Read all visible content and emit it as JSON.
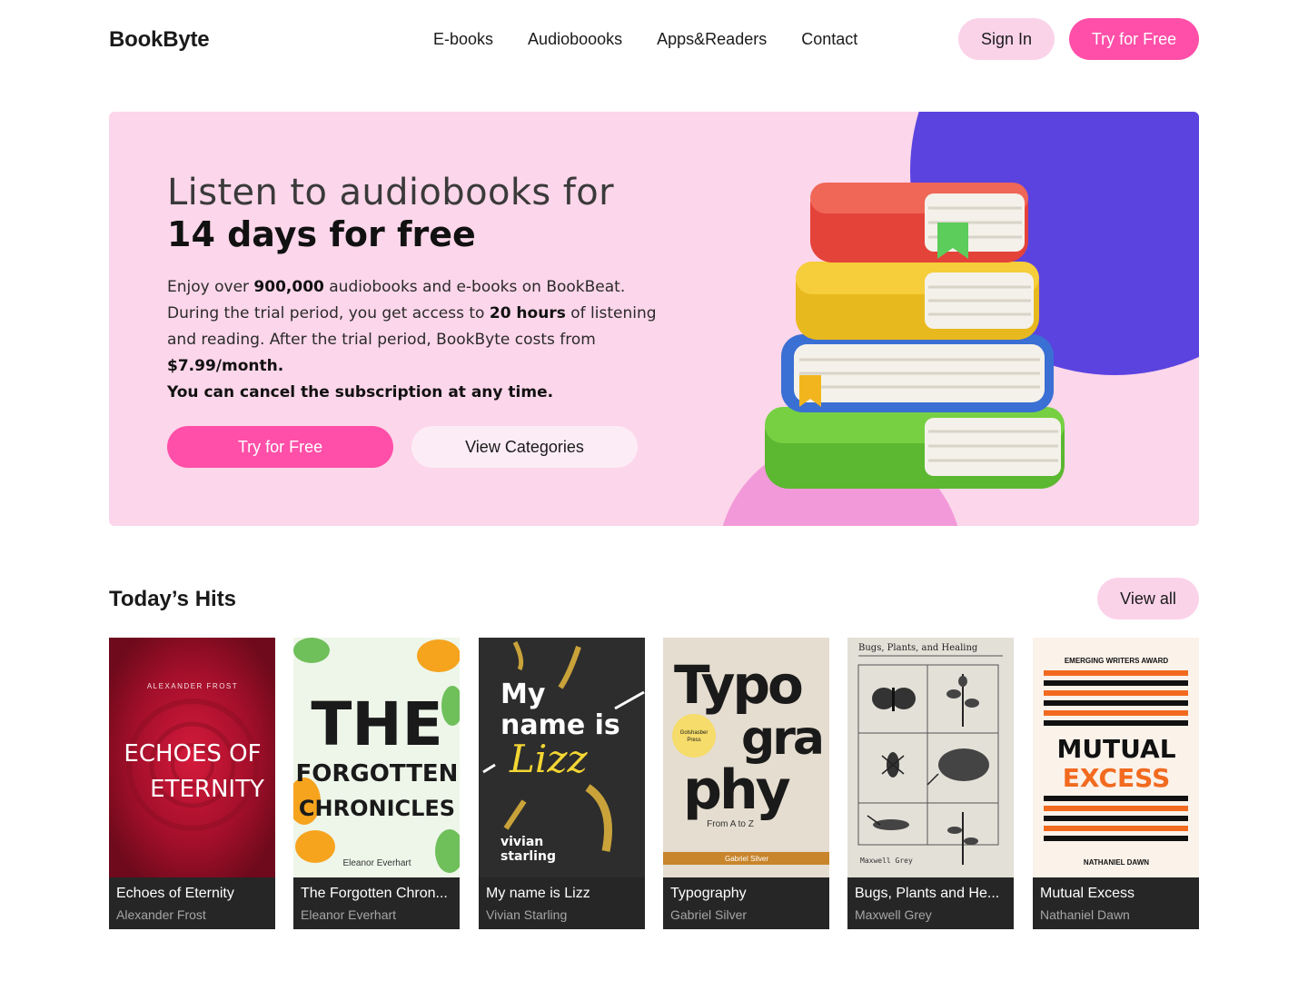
{
  "header": {
    "logo": "BookByte",
    "nav": [
      "E-books",
      "Audioboooks",
      "Apps&Readers",
      "Contact"
    ],
    "sign_in": "Sign In",
    "try_free": "Try for Free"
  },
  "hero": {
    "line1": "Listen to audiobooks for",
    "line2": "14 days for free",
    "desc": {
      "p1": "Enjoy over ",
      "b1": "900,000",
      "p2": " audiobooks and e-books on BookBeat. During the trial period, you get access to ",
      "b2": "20 hours",
      "p3": " of listening and reading. After the trial period, BookByte costs from ",
      "b3": "$7.99/month.",
      "cancel": "You can cancel the subscription at any time."
    },
    "try_free": "Try for Free",
    "view_categories": "View Categories",
    "colors": {
      "background": "#fcd6ea",
      "accent": "#ff4fa8",
      "purple": "#5b43e0"
    }
  },
  "hits": {
    "title": "Today’s Hits",
    "view_all": "View all",
    "books": [
      {
        "title": "Echoes of Eternity",
        "author": "Alexander Frost",
        "cover": {
          "author": "ALEXANDER FROST",
          "line1": "ECHOES OF",
          "line2": "ETERNITY"
        }
      },
      {
        "title": "The Forgotten Chron...",
        "author": "Eleanor Everhart",
        "cover": {
          "line1": "THE",
          "line2": "FORGOTTEN",
          "line3": "CHRONICLES",
          "author": "Eleanor Everhart"
        }
      },
      {
        "title": "My name is Lizz",
        "author": "Vivian Starling",
        "cover": {
          "line1": "My",
          "line2": "name is",
          "line3": "Lizz",
          "author1": "vivian",
          "author2": "starling"
        }
      },
      {
        "title": "Typography",
        "author": "Gabriel Silver",
        "cover": {
          "line1": "Typo",
          "line2": "gra",
          "line3": "phy",
          "badge1": "Golshasber",
          "badge2": "Press",
          "sub": "From A to Z",
          "author": "Gabriel Silver"
        }
      },
      {
        "title": "Bugs, Plants and He...",
        "author": "Maxwell Grey",
        "cover": {
          "title": "Bugs, Plants, and Healing",
          "author": "Maxwell Grey"
        }
      },
      {
        "title": "Mutual Excess",
        "author": "Nathaniel Dawn",
        "cover": {
          "award": "EMERGING WRITERS AWARD",
          "line1": "MUTUAL",
          "line2": "EXCESS",
          "author": "NATHANIEL DAWN"
        }
      }
    ]
  }
}
